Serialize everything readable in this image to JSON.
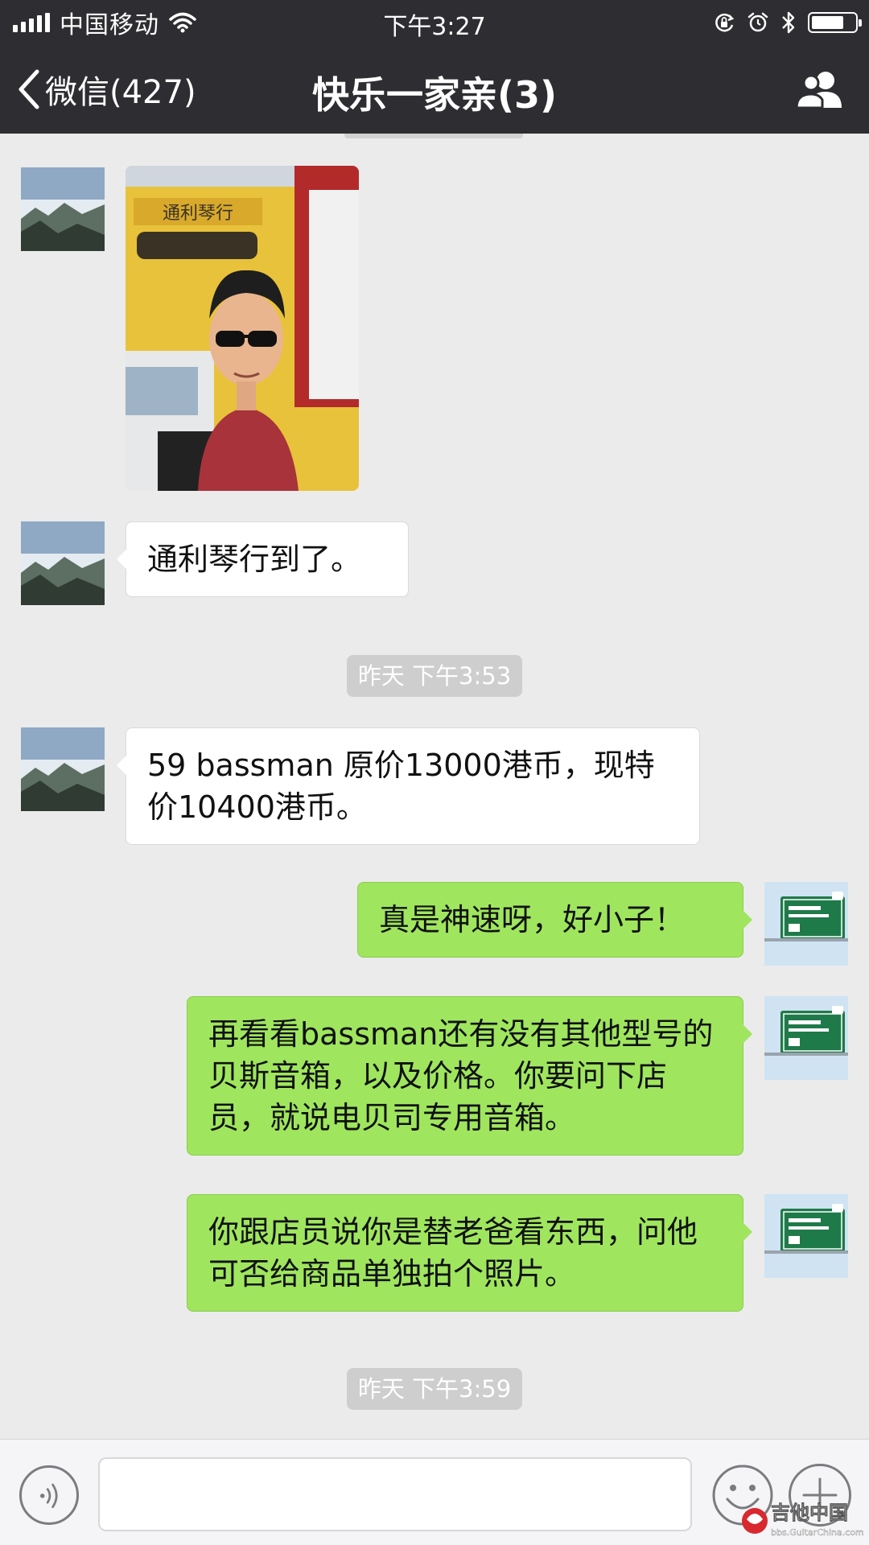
{
  "status_bar": {
    "carrier": "中国移动",
    "time": "下午3:27",
    "battery_level": 0.75
  },
  "nav": {
    "back_label": "微信(427)",
    "title": "快乐一家亲(3)"
  },
  "messages": [
    {
      "type": "image",
      "direction": "in",
      "avatar": "mountain-avatar",
      "image": "selfie-photo",
      "shop_sign_text": "通利琴行"
    },
    {
      "type": "text",
      "direction": "in",
      "avatar": "mountain-avatar",
      "text": "通利琴行到了。"
    },
    {
      "type": "timestamp",
      "text": "昨天 下午3:53"
    },
    {
      "type": "text",
      "direction": "in",
      "avatar": "mountain-avatar",
      "text": "59 bassman 原价13000港币，现特价10400港币。"
    },
    {
      "type": "text",
      "direction": "out",
      "avatar": "road-sign-avatar",
      "text": "真是神速呀，好小子！"
    },
    {
      "type": "text",
      "direction": "out",
      "avatar": "road-sign-avatar",
      "text": "再看看bassman还有没有其他型号的贝斯音箱，以及价格。你要问下店员，就说电贝司专用音箱。"
    },
    {
      "type": "text",
      "direction": "out",
      "avatar": "road-sign-avatar",
      "text": "你跟店员说你是替老爸看东西，问他可否给商品单独拍个照片。"
    },
    {
      "type": "timestamp",
      "text": "昨天 下午3:59"
    }
  ],
  "input": {
    "value": "",
    "placeholder": ""
  },
  "watermark": {
    "title": "吉他中国",
    "url": "bbs.GuitarChina.com"
  },
  "colors": {
    "nav_background": "#2e2e32",
    "chat_background": "#ebebeb",
    "incoming_bubble": "#ffffff",
    "outgoing_bubble": "#9fe65e",
    "timestamp_pill": "#cecece"
  }
}
